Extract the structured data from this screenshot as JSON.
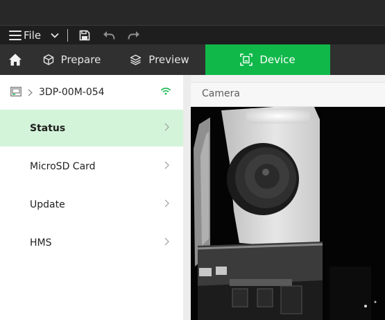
{
  "menu": {
    "file_label": "File"
  },
  "tabs": [
    {
      "label": "Prepare",
      "icon": "cube-icon"
    },
    {
      "label": "Preview",
      "icon": "layers-icon"
    },
    {
      "label": "Device",
      "icon": "device-icon",
      "active": true
    }
  ],
  "colors": {
    "accent": "#10b84a",
    "active_row": "#d3f4d9",
    "tabbar": "#303030",
    "menubar": "#1e1e1e",
    "titlebar": "#282828"
  },
  "device": {
    "name": "3DP-00M-054",
    "connection_icon": "wifi-icon"
  },
  "sidebar": {
    "items": [
      {
        "label": "Status",
        "active": true
      },
      {
        "label": "MicroSD Card"
      },
      {
        "label": "Update"
      },
      {
        "label": "HMS"
      }
    ]
  },
  "camera": {
    "title": "Camera"
  }
}
